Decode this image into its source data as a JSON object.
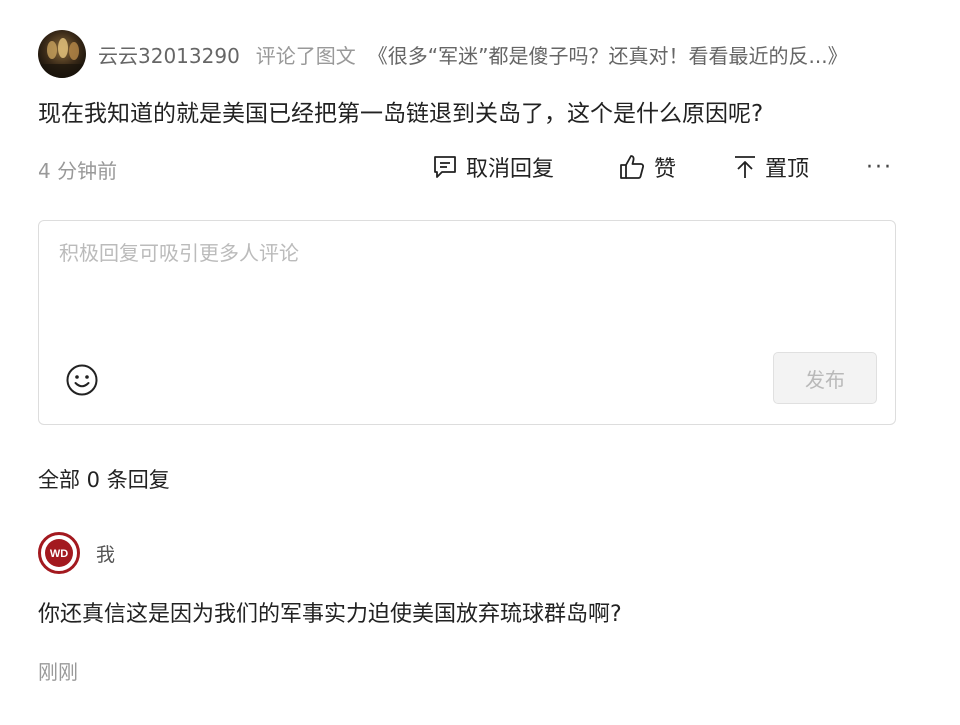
{
  "comment": {
    "avatar_icon": "user-photo-avatar",
    "username": "云云32013290",
    "action_text": "评论了图文",
    "article_title": "《很多“军迷”都是傻子吗？还真对！看看最近的反...》",
    "text": "现在我知道的就是美国已经把第一岛链退到关岛了，这个是什么原因呢?",
    "time": "4 分钟前",
    "actions": {
      "cancel_reply": "取消回复",
      "like": "赞",
      "pin": "置顶",
      "more": "···"
    }
  },
  "reply_box": {
    "placeholder": "积极回复可吸引更多人评论",
    "value": "",
    "emoji_icon": "smiley-icon",
    "publish_label": "发布"
  },
  "replies": {
    "count_label": "全部 0 条回复",
    "items": [
      {
        "avatar_icon": "wd-logo-avatar",
        "username": "我",
        "text": "你还真信这是因为我们的军事实力迫使美国放弃琉球群岛啊?",
        "time": "刚刚"
      }
    ]
  },
  "colors": {
    "text_primary": "#222222",
    "text_muted": "#999999",
    "avatar_red": "#a3191f",
    "border": "#dddddd"
  }
}
